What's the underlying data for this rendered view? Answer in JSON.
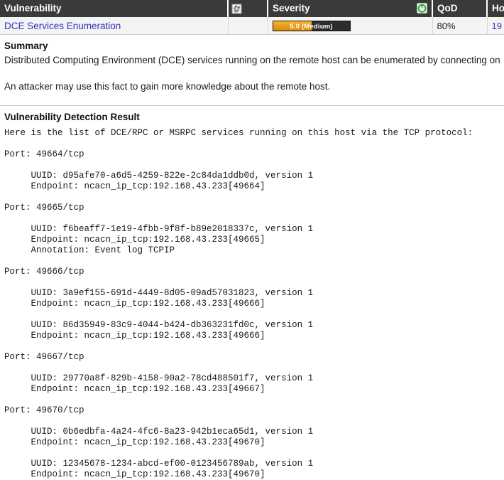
{
  "table": {
    "headers": {
      "vulnerability": "Vulnerability",
      "solution_type_icon": "solution-type-icon",
      "severity": "Severity",
      "severity_class_icon": "severity-class-icon",
      "qod": "QoD",
      "host": "Ho"
    },
    "row": {
      "vulnerability": "DCE Services Enumeration",
      "severity_score": "5.0",
      "severity_label": "Medium",
      "severity_text": "5.0 (Medium)",
      "severity_percent": 50,
      "severity_color": "#e89b16",
      "qod": "80%",
      "host": "19"
    }
  },
  "summary": {
    "title": "Summary",
    "paragraph1": "Distributed Computing Environment (DCE) services running on the remote host can be enumerated by connecting on",
    "paragraph2": "An attacker may use this fact to gain more knowledge about the remote host."
  },
  "detection": {
    "title": "Vulnerability Detection Result",
    "text": "Here is the list of DCE/RPC or MSRPC services running on this host via the TCP protocol:\n\nPort: 49664/tcp\n\n     UUID: d95afe70-a6d5-4259-822e-2c84da1ddb0d, version 1\n     Endpoint: ncacn_ip_tcp:192.168.43.233[49664]\n\nPort: 49665/tcp\n\n     UUID: f6beaff7-1e19-4fbb-9f8f-b89e2018337c, version 1\n     Endpoint: ncacn_ip_tcp:192.168.43.233[49665]\n     Annotation: Event log TCPIP\n\nPort: 49666/tcp\n\n     UUID: 3a9ef155-691d-4449-8d05-09ad57031823, version 1\n     Endpoint: ncacn_ip_tcp:192.168.43.233[49666]\n\n     UUID: 86d35949-83c9-4044-b424-db363231fd0c, version 1\n     Endpoint: ncacn_ip_tcp:192.168.43.233[49666]\n\nPort: 49667/tcp\n\n     UUID: 29770a8f-829b-4158-90a2-78cd488501f7, version 1\n     Endpoint: ncacn_ip_tcp:192.168.43.233[49667]\n\nPort: 49670/tcp\n\n     UUID: 0b6edbfa-4a24-4fc6-8a23-942b1eca65d1, version 1\n     Endpoint: ncacn_ip_tcp:192.168.43.233[49670]\n\n     UUID: 12345678-1234-abcd-ef00-0123456789ab, version 1\n     Endpoint: ncacn_ip_tcp:192.168.43.233[49670]"
  }
}
